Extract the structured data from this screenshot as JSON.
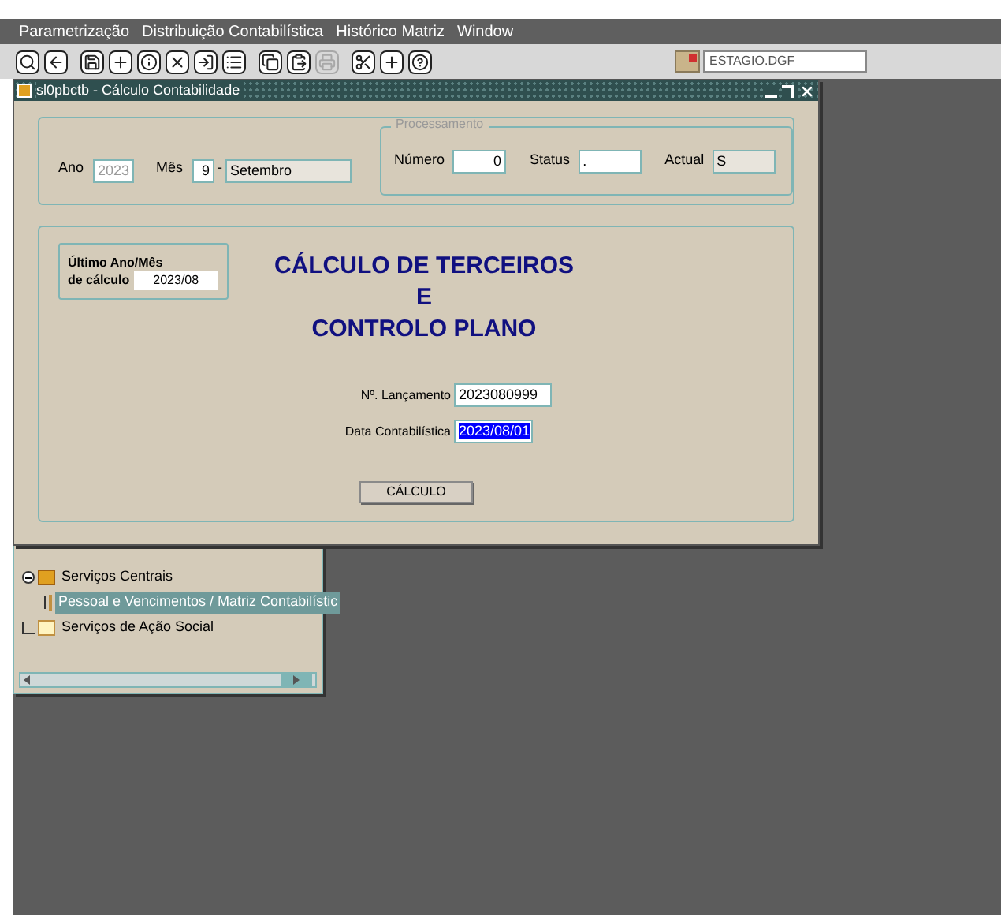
{
  "menu": [
    {
      "label": "Parametrização"
    },
    {
      "label": "Distribuição Contabilística"
    },
    {
      "label": "Histórico Matriz"
    },
    {
      "label": "Window"
    }
  ],
  "toolbar": [
    {
      "kind": "search",
      "disabled": false
    },
    {
      "kind": "back",
      "disabled": false
    },
    {
      "kind": "save",
      "disabled": false
    },
    {
      "kind": "add",
      "disabled": false
    },
    {
      "kind": "info",
      "disabled": false
    },
    {
      "kind": "delete",
      "disabled": false
    },
    {
      "kind": "enter",
      "disabled": false
    },
    {
      "kind": "list",
      "disabled": false
    },
    {
      "kind": "copy",
      "disabled": false
    },
    {
      "kind": "paste",
      "disabled": false
    },
    {
      "kind": "print",
      "disabled": true
    },
    {
      "kind": "cut",
      "disabled": false
    },
    {
      "kind": "add",
      "disabled": false
    },
    {
      "kind": "help",
      "disabled": false
    }
  ],
  "user_field": {
    "value": "ESTAGIO.DGF"
  },
  "tree_window": {
    "items": [
      {
        "label": "Serviços Centrais",
        "expanded": true,
        "selected": false,
        "children": [
          {
            "label": "Pessoal e Vencimentos / Matriz Contabilístic",
            "selected": true
          }
        ]
      },
      {
        "label": "Serviços de Ação Social",
        "selected": false
      }
    ]
  },
  "window": {
    "title": "sl0pbctb - Cálculo Contabilidade",
    "period": {
      "year_label": "Ano",
      "year": "2023",
      "year_disabled": true,
      "month_label": "Mês",
      "month": "9",
      "separator": "-",
      "month_name": "Setembro"
    },
    "processing": {
      "legend": "Processamento",
      "fields": [
        {
          "label": "Número",
          "value": "0",
          "readonly": false
        },
        {
          "label": "Status",
          "value": ".",
          "readonly": false
        },
        {
          "label": "Actual",
          "value": "S",
          "readonly": true
        }
      ]
    },
    "last_period": {
      "label_1": "Último Ano/Mês",
      "label_2": "de cálculo",
      "value": "2023/08"
    },
    "heading": [
      "CÁLCULO DE TERCEIROS",
      "E",
      "CONTROLO PLANO"
    ],
    "fields": [
      {
        "label": "Nº. Lançamento",
        "value": "2023080999",
        "selected": false
      },
      {
        "label": "Data Contabilística",
        "value": "2023/08/01",
        "selected": true
      }
    ],
    "button": "CÁLCULO"
  }
}
